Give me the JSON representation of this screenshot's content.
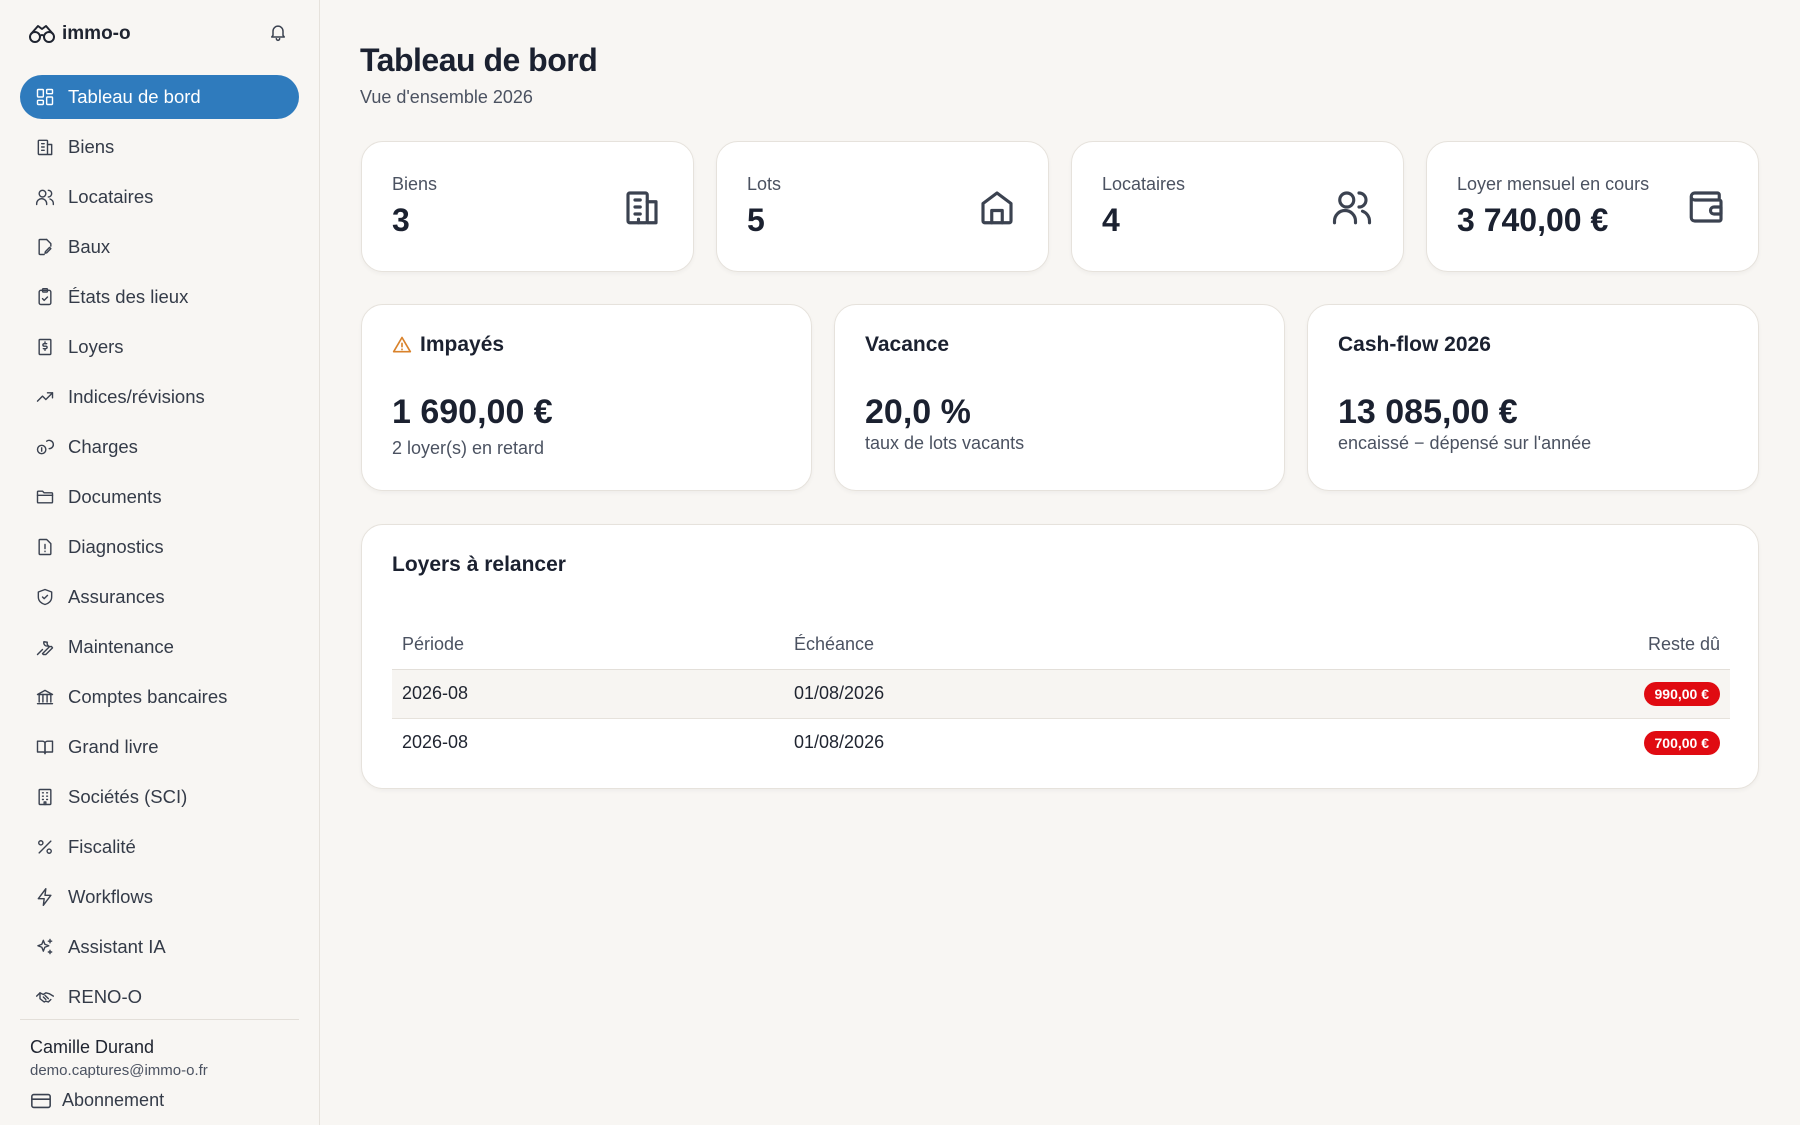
{
  "app": {
    "name": "immo-o"
  },
  "sidebar": {
    "items": [
      {
        "label": "Tableau de bord",
        "icon": "dashboard-icon",
        "active": true
      },
      {
        "label": "Biens",
        "icon": "building-icon"
      },
      {
        "label": "Locataires",
        "icon": "users-icon"
      },
      {
        "label": "Baux",
        "icon": "file-edit-icon"
      },
      {
        "label": "États des lieux",
        "icon": "clipboard-icon"
      },
      {
        "label": "Loyers",
        "icon": "receipt-icon"
      },
      {
        "label": "Indices/révisions",
        "icon": "trending-up-icon"
      },
      {
        "label": "Charges",
        "icon": "coins-icon"
      },
      {
        "label": "Documents",
        "icon": "folder-icon"
      },
      {
        "label": "Diagnostics",
        "icon": "file-alert-icon"
      },
      {
        "label": "Assurances",
        "icon": "shield-check-icon"
      },
      {
        "label": "Maintenance",
        "icon": "wrench-icon"
      },
      {
        "label": "Comptes bancaires",
        "icon": "bank-icon"
      },
      {
        "label": "Grand livre",
        "icon": "book-icon"
      },
      {
        "label": "Sociétés (SCI)",
        "icon": "office-icon"
      },
      {
        "label": "Fiscalité",
        "icon": "percent-icon"
      },
      {
        "label": "Workflows",
        "icon": "zap-icon"
      },
      {
        "label": "Assistant IA",
        "icon": "sparkles-icon"
      },
      {
        "label": "RENO-O",
        "icon": "handshake-icon"
      }
    ],
    "user": {
      "name": "Camille Durand",
      "email": "demo.captures@immo-o.fr"
    },
    "subscription_label": "Abonnement"
  },
  "header": {
    "title": "Tableau de bord",
    "subtitle": "Vue d'ensemble 2026"
  },
  "stats": {
    "biens": {
      "label": "Biens",
      "value": "3"
    },
    "lots": {
      "label": "Lots",
      "value": "5"
    },
    "locataires": {
      "label": "Locataires",
      "value": "4"
    },
    "loyer": {
      "label": "Loyer mensuel en cours",
      "value": "3 740,00 €"
    }
  },
  "kpis": {
    "impayes": {
      "title": "Impayés",
      "value": "1 690,00 €",
      "caption": "2 loyer(s) en retard"
    },
    "vacance": {
      "title": "Vacance",
      "value": "20,0 %",
      "caption": "taux de lots vacants"
    },
    "cashflow": {
      "title": "Cash-flow 2026",
      "value": "13 085,00 €",
      "caption": "encaissé − dépensé sur l'année"
    }
  },
  "relance": {
    "title": "Loyers à relancer",
    "columns": {
      "periode": "Période",
      "echeance": "Échéance",
      "reste": "Reste dû"
    },
    "rows": [
      {
        "periode": "2026-08",
        "echeance": "01/08/2026",
        "reste": "990,00 €"
      },
      {
        "periode": "2026-08",
        "echeance": "01/08/2026",
        "reste": "700,00 €"
      }
    ]
  },
  "colors": {
    "accent": "#2f7bbd",
    "danger": "#e00b12",
    "warning": "#d9822b",
    "background": "#f8f6f3"
  }
}
